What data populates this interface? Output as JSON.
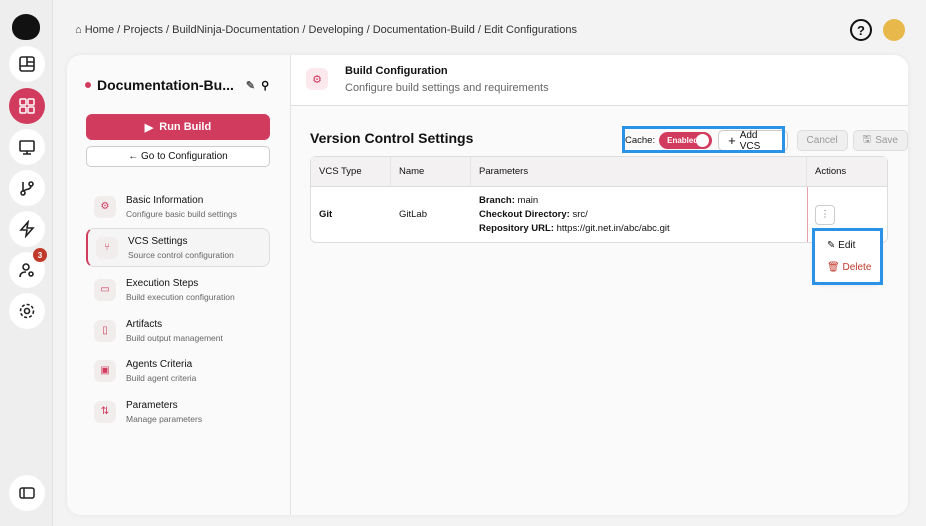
{
  "breadcrumb": [
    "Home",
    "Projects",
    "BuildNinja-Documentation",
    "Developing",
    "Documentation-Build",
    "Edit Configurations"
  ],
  "rail": {
    "notification_count": "3"
  },
  "sidebar": {
    "title": "Documentation-Bu...",
    "run_build": "Run Build",
    "go_to_config": "← Go to Configuration",
    "items": [
      {
        "label": "Basic Information",
        "sub": "Configure basic build settings",
        "icon": "gear-icon"
      },
      {
        "label": "VCS Settings",
        "sub": "Source control configuration",
        "icon": "branch-icon"
      },
      {
        "label": "Execution Steps",
        "sub": "Build execution configuration",
        "icon": "steps-icon"
      },
      {
        "label": "Artifacts",
        "sub": "Build output management",
        "icon": "file-icon"
      },
      {
        "label": "Agents Criteria",
        "sub": "Build agent criteria",
        "icon": "agent-icon"
      },
      {
        "label": "Parameters",
        "sub": "Manage parameters",
        "icon": "sliders-icon"
      }
    ]
  },
  "header": {
    "title": "Build Configuration",
    "subtitle": "Configure build settings and requirements"
  },
  "section": {
    "title": "Version Control Settings",
    "cache_label": "Cache:",
    "cache_state": "Enabled",
    "add_vcs": "Add VCS",
    "cancel": "Cancel",
    "save": "Save"
  },
  "table": {
    "headers": [
      "VCS Type",
      "Name",
      "Parameters",
      "Actions"
    ],
    "rows": [
      {
        "type": "Git",
        "name": "GitLab",
        "branch_label": "Branch:",
        "branch": "main",
        "dir_label": "Checkout Directory:",
        "dir": "src/",
        "url_label": "Repository URL:",
        "url": "https://git.net.in/abc/abc.git"
      }
    ]
  },
  "menu": {
    "edit": "Edit",
    "delete": "Delete"
  },
  "colors": {
    "accent": "#d13b5e",
    "highlight": "#2a93e8"
  }
}
